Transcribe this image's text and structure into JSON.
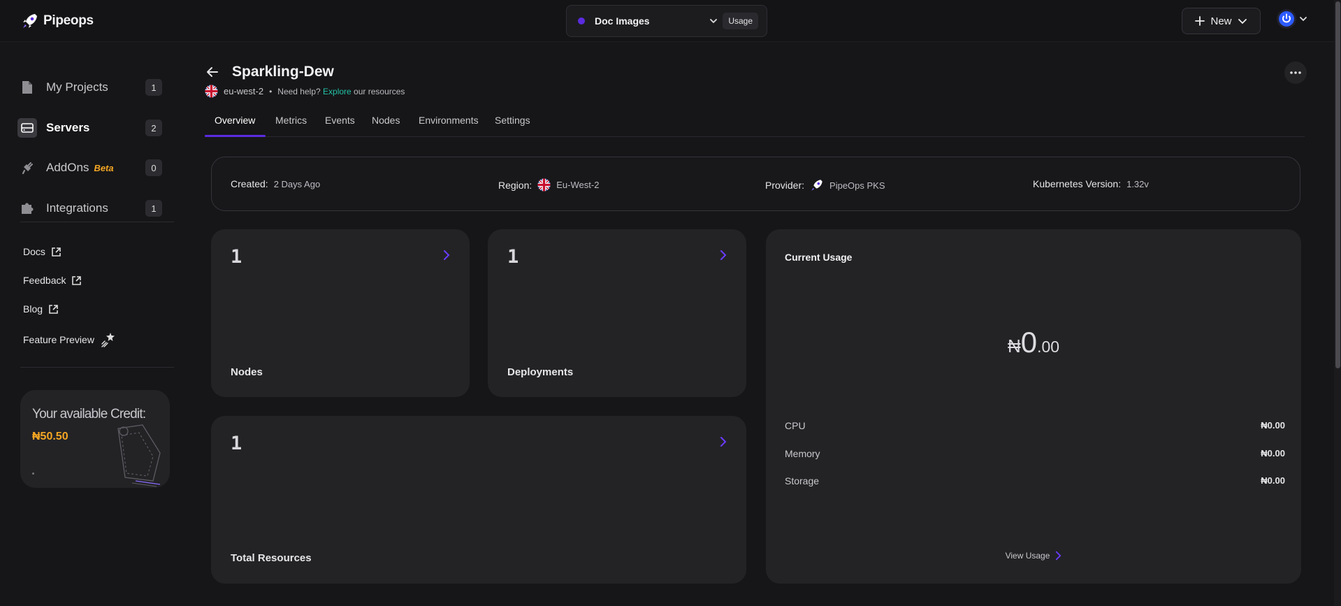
{
  "app": {
    "brand": "Pipeops"
  },
  "header": {
    "project_name": "Doc Images",
    "usage_label": "Usage",
    "new_label": "New"
  },
  "sidebar": {
    "items": [
      {
        "label": "My Projects",
        "count": "1"
      },
      {
        "label": "Servers",
        "count": "2"
      },
      {
        "label": "AddOns",
        "badge": "Beta",
        "count": "0"
      },
      {
        "label": "Integrations",
        "count": "1"
      }
    ],
    "links": [
      {
        "label": "Docs"
      },
      {
        "label": "Feedback"
      },
      {
        "label": "Blog"
      },
      {
        "label": "Feature Preview"
      }
    ],
    "credit": {
      "title": "Your available Credit:",
      "amount": "₦50.50"
    }
  },
  "server": {
    "name": "Sparkling-Dew",
    "region_code": "eu-west-2",
    "help_text": "Need help?",
    "help_link": "Explore",
    "help_suffix": "our resources"
  },
  "tabs": [
    {
      "label": "Overview",
      "active": true
    },
    {
      "label": "Metrics"
    },
    {
      "label": "Events"
    },
    {
      "label": "Nodes"
    },
    {
      "label": "Environments"
    },
    {
      "label": "Settings"
    }
  ],
  "info": {
    "created_label": "Created:",
    "created_value": "2 Days Ago",
    "region_label": "Region:",
    "region_value": "Eu-West-2",
    "provider_label": "Provider:",
    "provider_value": "PipeOps PKS",
    "k8s_label": "Kubernetes Version:",
    "k8s_value": "1.32v"
  },
  "stats": {
    "nodes": {
      "value": "1",
      "label": "Nodes"
    },
    "deployments": {
      "value": "1",
      "label": "Deployments"
    },
    "resources": {
      "value": "1",
      "label": "Total Resources"
    }
  },
  "usage": {
    "title": "Current Usage",
    "currency": "₦",
    "total_int": "0",
    "total_dec": ".00",
    "rows": [
      {
        "label": "CPU",
        "value": "₦0.00"
      },
      {
        "label": "Memory",
        "value": "₦0.00"
      },
      {
        "label": "Storage",
        "value": "₦0.00"
      }
    ],
    "view_label": "View Usage"
  },
  "colors": {
    "accent": "#5b2be0",
    "credit": "#f5a623",
    "link": "#22c3a6"
  }
}
